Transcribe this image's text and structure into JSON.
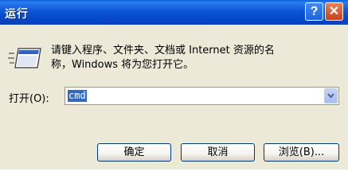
{
  "window": {
    "title": "运行",
    "help_glyph": "?",
    "close_glyph": "✕"
  },
  "description": {
    "line1": "请键入程序、文件夹、文档或 Internet 资源的名",
    "line2": "称，Windows 将为您打开它。"
  },
  "open_field": {
    "label": "打开(O):",
    "value": "cmd"
  },
  "buttons": {
    "ok": "确定",
    "cancel": "取消",
    "browse": "浏览(B)..."
  },
  "icons": {
    "run_icon": "run-program-icon",
    "dropdown_icon": "chevron-down-icon"
  }
}
